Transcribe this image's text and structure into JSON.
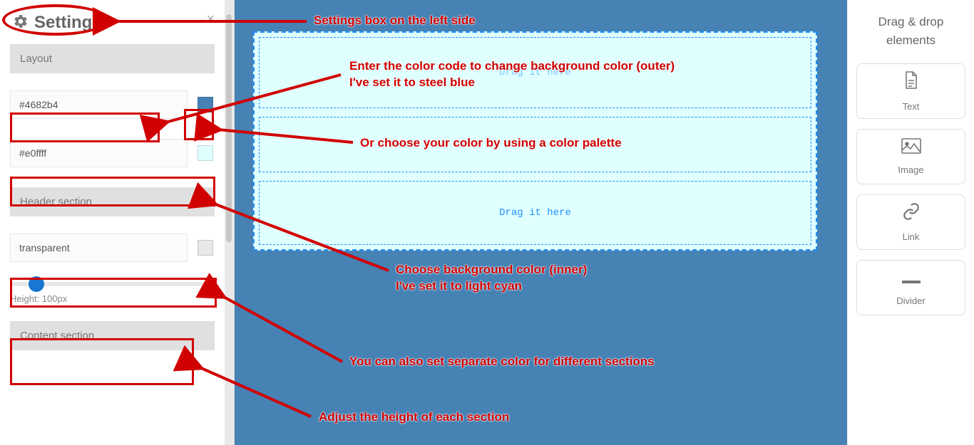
{
  "settings": {
    "title": "Settings",
    "sections": {
      "layout": {
        "heading": "Layout",
        "outer_color_value": "#4682b4",
        "outer_swatch_hex": "#4682b4",
        "inner_color_value": "#e0ffff",
        "inner_swatch_hex": "#e0ffff"
      },
      "header": {
        "heading": "Header section",
        "color_value": "transparent",
        "swatch_hex": "#e0e0e0",
        "height_label": "Height: 100px"
      },
      "content": {
        "heading": "Content section"
      }
    }
  },
  "canvas": {
    "outer_bg": "#4682b4",
    "inner_bg": "#e0ffff",
    "dropzone_text": "Drag it here",
    "dropzone_text_partial": "Drag it here"
  },
  "right_panel": {
    "title_line1": "Drag & drop",
    "title_line2": "elements",
    "items": [
      {
        "label": "Text",
        "icon": "file-text-icon"
      },
      {
        "label": "Image",
        "icon": "image-icon"
      },
      {
        "label": "Link",
        "icon": "link-icon"
      },
      {
        "label": "Divider",
        "icon": "divider-icon"
      }
    ]
  },
  "annotations": {
    "a1": "Settings box on the left side",
    "a2_l1": "Enter the color code to change background color (outer)",
    "a2_l2": "I've set it to steel blue",
    "a3": "Or choose your color by using a color palette",
    "a4_l1": "Choose background color (inner)",
    "a4_l2": "I've set it to light cyan",
    "a5": "You can also set separate color for different sections",
    "a6": "Adjust the height of each section"
  }
}
